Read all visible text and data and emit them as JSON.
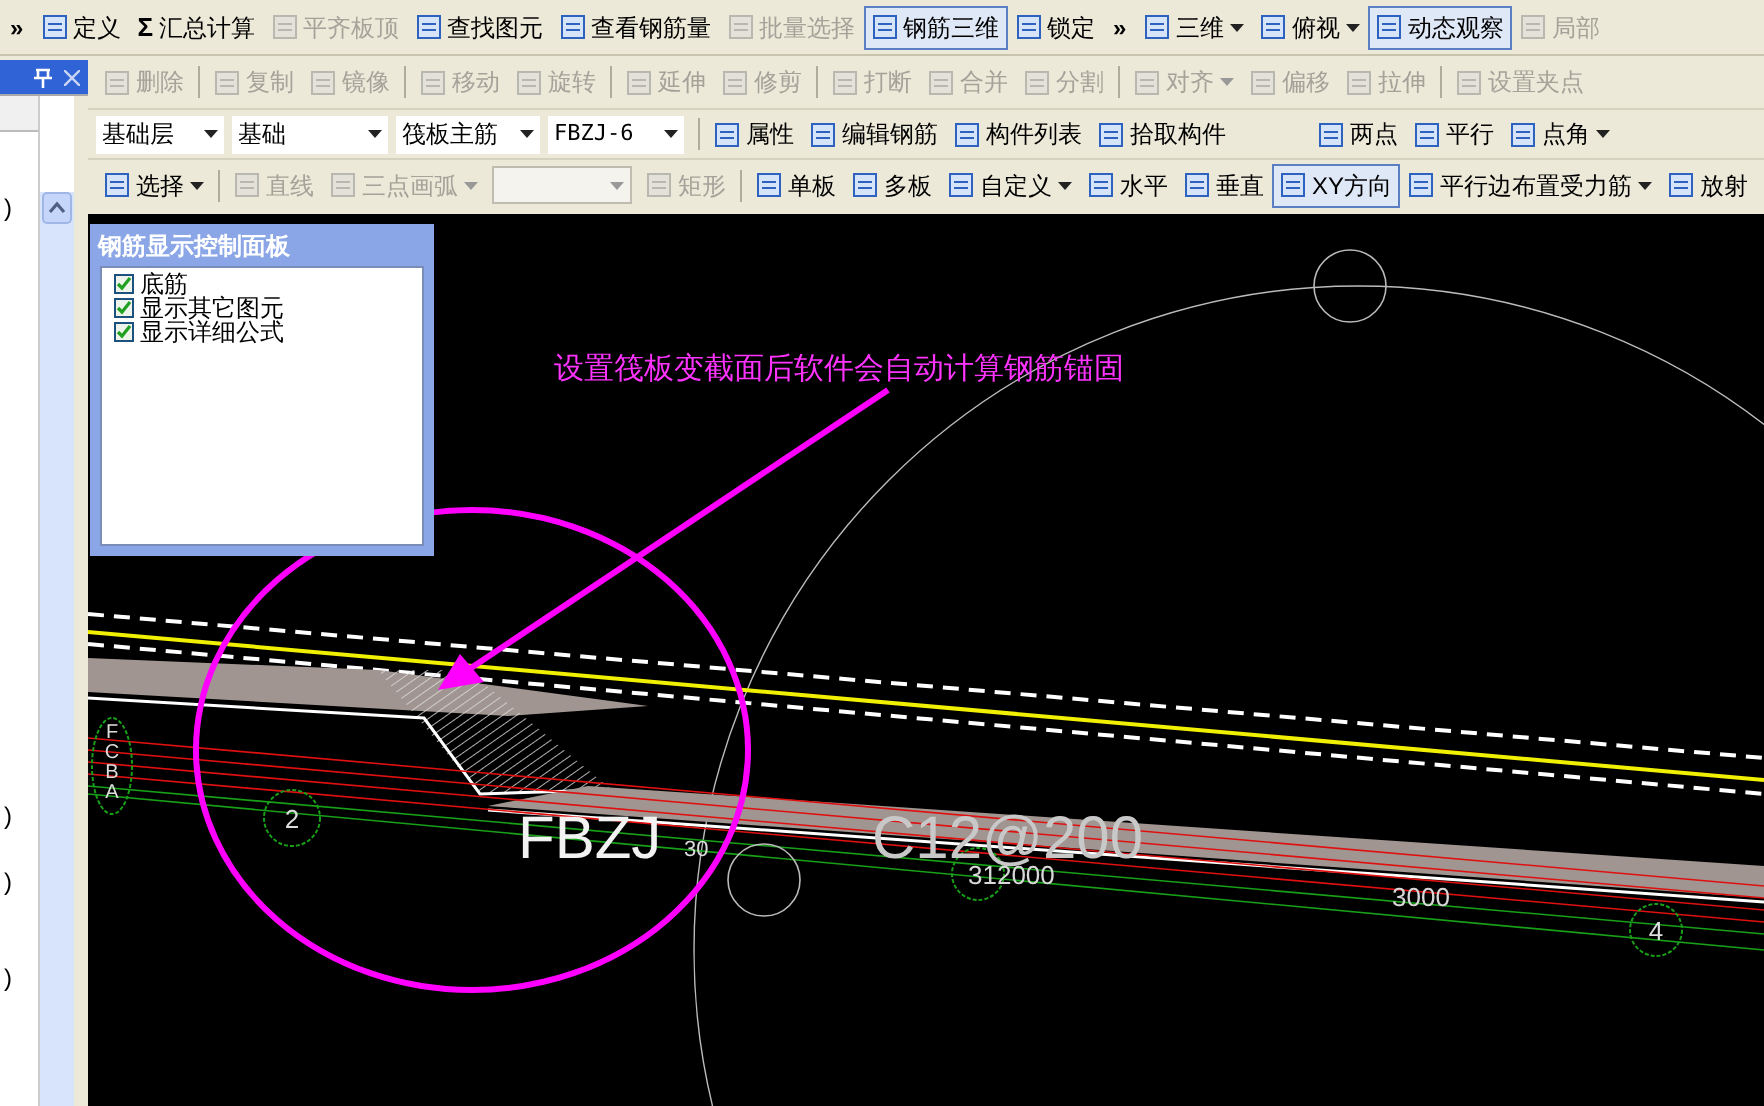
{
  "toolbar_rows": [
    {
      "items": [
        {
          "kind": "chevron",
          "label": "»"
        },
        {
          "kind": "button",
          "label": "定义",
          "disabled": false,
          "selected": false
        },
        {
          "kind": "glyph",
          "icon_text": "Σ",
          "label": "汇总计算",
          "disabled": false,
          "selected": false
        },
        {
          "kind": "button",
          "label": "平齐板顶",
          "disabled": true,
          "selected": false
        },
        {
          "kind": "button",
          "label": "查找图元",
          "disabled": false,
          "selected": false
        },
        {
          "kind": "button",
          "label": "查看钢筋量",
          "disabled": false,
          "selected": false
        },
        {
          "kind": "button",
          "label": "批量选择",
          "disabled": true,
          "selected": false
        },
        {
          "kind": "button",
          "label": "钢筋三维",
          "disabled": false,
          "selected": true
        },
        {
          "kind": "button",
          "label": "锁定",
          "disabled": false,
          "selected": false
        },
        {
          "kind": "chevron",
          "label": "»"
        },
        {
          "kind": "dropdown",
          "label": "三维",
          "disabled": false,
          "selected": false
        },
        {
          "kind": "dropdown",
          "label": "俯视",
          "disabled": false,
          "selected": false
        },
        {
          "kind": "button",
          "label": "动态观察",
          "disabled": false,
          "selected": true
        },
        {
          "kind": "button",
          "label": "局部",
          "disabled": true,
          "selected": false
        }
      ]
    },
    {
      "items": [
        {
          "kind": "button",
          "label": "删除",
          "disabled": true,
          "selected": false
        },
        {
          "kind": "separator"
        },
        {
          "kind": "button",
          "label": "复制",
          "disabled": true,
          "selected": false
        },
        {
          "kind": "button",
          "label": "镜像",
          "disabled": true,
          "selected": false
        },
        {
          "kind": "separator"
        },
        {
          "kind": "button",
          "label": "移动",
          "disabled": true,
          "selected": false
        },
        {
          "kind": "button",
          "label": "旋转",
          "disabled": true,
          "selected": false
        },
        {
          "kind": "separator"
        },
        {
          "kind": "button",
          "label": "延伸",
          "disabled": true,
          "selected": false
        },
        {
          "kind": "button",
          "label": "修剪",
          "disabled": true,
          "selected": false
        },
        {
          "kind": "separator"
        },
        {
          "kind": "button",
          "label": "打断",
          "disabled": true,
          "selected": false
        },
        {
          "kind": "button",
          "label": "合并",
          "disabled": true,
          "selected": false
        },
        {
          "kind": "button",
          "label": "分割",
          "disabled": true,
          "selected": false
        },
        {
          "kind": "separator"
        },
        {
          "kind": "dropdown",
          "label": "对齐",
          "disabled": true,
          "selected": false
        },
        {
          "kind": "button",
          "label": "偏移",
          "disabled": true,
          "selected": false
        },
        {
          "kind": "button",
          "label": "拉伸",
          "disabled": true,
          "selected": false
        },
        {
          "kind": "separator"
        },
        {
          "kind": "button",
          "label": "设置夹点",
          "disabled": true,
          "selected": false
        }
      ]
    },
    {
      "items": [
        {
          "kind": "combo",
          "value": "基础层"
        },
        {
          "kind": "combo",
          "value": "基础"
        },
        {
          "kind": "combo",
          "value": "筏板主筋"
        },
        {
          "kind": "combo",
          "value": "FBZJ-6"
        },
        {
          "kind": "separator"
        },
        {
          "kind": "button",
          "label": "属性",
          "disabled": false,
          "selected": false
        },
        {
          "kind": "button",
          "label": "编辑钢筋",
          "disabled": false,
          "selected": false
        },
        {
          "kind": "button",
          "label": "构件列表",
          "disabled": false,
          "selected": false
        },
        {
          "kind": "button",
          "label": "拾取构件",
          "disabled": false,
          "selected": false
        },
        {
          "kind": "gap"
        },
        {
          "kind": "button",
          "label": "两点",
          "disabled": false,
          "selected": false
        },
        {
          "kind": "button",
          "label": "平行",
          "disabled": false,
          "selected": false
        },
        {
          "kind": "dropdown",
          "label": "点角",
          "disabled": false,
          "selected": false
        }
      ]
    },
    {
      "items": [
        {
          "kind": "dropdown",
          "label": "选择",
          "disabled": false,
          "selected": false
        },
        {
          "kind": "separator"
        },
        {
          "kind": "button",
          "label": "直线",
          "disabled": true,
          "selected": false
        },
        {
          "kind": "dropdown",
          "label": "三点画弧",
          "disabled": true,
          "selected": false
        },
        {
          "kind": "emptycombo",
          "disabled": true
        },
        {
          "kind": "button",
          "label": "矩形",
          "disabled": true,
          "selected": false
        },
        {
          "kind": "separator"
        },
        {
          "kind": "button",
          "label": "单板",
          "disabled": false,
          "selected": false
        },
        {
          "kind": "button",
          "label": "多板",
          "disabled": false,
          "selected": false
        },
        {
          "kind": "dropdown",
          "label": "自定义",
          "disabled": false,
          "selected": false
        },
        {
          "kind": "button",
          "label": "水平",
          "disabled": false,
          "selected": false
        },
        {
          "kind": "button",
          "label": "垂直",
          "disabled": false,
          "selected": false
        },
        {
          "kind": "button",
          "label": "XY方向",
          "disabled": false,
          "selected": true
        },
        {
          "kind": "dropdown",
          "label": "平行边布置受力筋",
          "disabled": false,
          "selected": false
        },
        {
          "kind": "button",
          "label": "放射",
          "disabled": false,
          "selected": false
        }
      ]
    }
  ],
  "dock_panel": {
    "row_marks": [
      ")",
      ")",
      ")",
      ")"
    ]
  },
  "control_panel": {
    "title": "钢筋显示控制面板",
    "options": [
      {
        "label": "底筋",
        "checked": true
      },
      {
        "label": "显示其它图元",
        "checked": true
      },
      {
        "label": "显示详细公式",
        "checked": true
      }
    ]
  },
  "canvas": {
    "annotation": "设置筏板变截面后软件会自动计算钢筋锚固",
    "labels": [
      {
        "kind": "big",
        "text": "FBZJ"
      },
      {
        "kind": "small",
        "text": "30"
      },
      {
        "kind": "big",
        "text": "C12@200"
      },
      {
        "kind": "dim",
        "text": "312000"
      },
      {
        "kind": "dim",
        "text": "3000"
      },
      {
        "kind": "axis",
        "text": "2"
      },
      {
        "kind": "axis",
        "text": "4"
      },
      {
        "kind": "axisv",
        "text": "FCBA"
      }
    ]
  }
}
